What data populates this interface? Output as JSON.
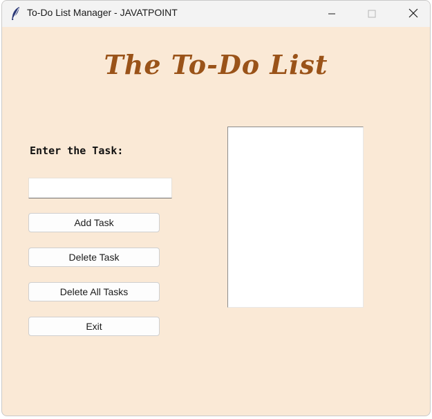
{
  "window": {
    "title": "To-Do List Manager - JAVATPOINT",
    "icon": "feather-icon",
    "controls": [
      "minimize-icon",
      "maximize-icon",
      "close-icon"
    ]
  },
  "header": {
    "title": "The To-Do List"
  },
  "form": {
    "label": "Enter the Task:",
    "input_value": "",
    "input_placeholder": ""
  },
  "buttons": {
    "add": "Add Task",
    "delete": "Delete Task",
    "delete_all": "Delete All Tasks",
    "exit": "Exit"
  },
  "task_list": {
    "items": []
  },
  "colors": {
    "background": "#fae9d6",
    "heading": "#9a5319",
    "titlebar": "#f3f3f3"
  }
}
